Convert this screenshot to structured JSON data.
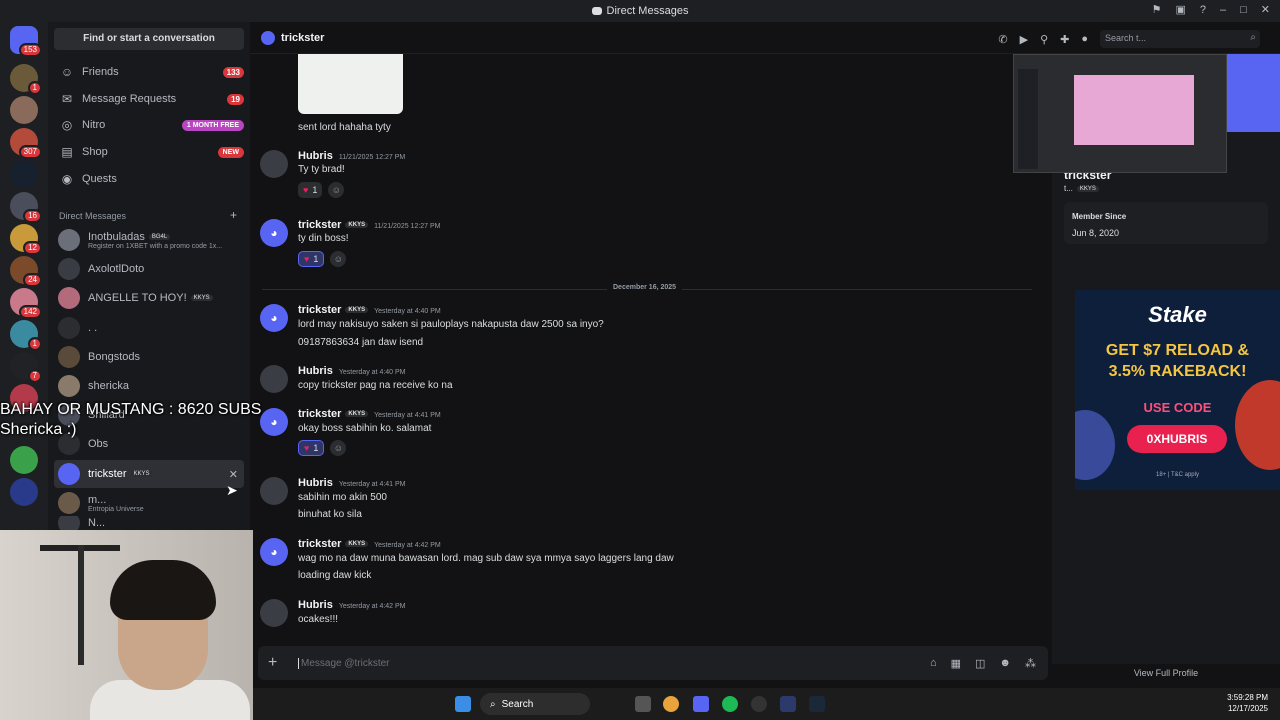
{
  "window": {
    "title": "Direct Messages"
  },
  "sidebar": {
    "find_label": "Find or start a conversation",
    "nav": [
      {
        "label": "Friends",
        "count": "133",
        "icon": "friends-icon"
      },
      {
        "label": "Message Requests",
        "count": "19",
        "icon": "mail-icon"
      },
      {
        "label": "Nitro",
        "pill": "1 MONTH FREE",
        "icon": "nitro-icon"
      },
      {
        "label": "Shop",
        "pill": "NEW",
        "icon": "shop-icon"
      },
      {
        "label": "Quests",
        "icon": "quests-icon"
      }
    ],
    "dm_header": "Direct Messages",
    "dms": [
      {
        "name": "Inotbuladas",
        "tag": "BG4L",
        "sub": "Register on 1XBET with a promo code 1x..."
      },
      {
        "name": "AxolotlDoto"
      },
      {
        "name": "ANGELLE TO HOY!",
        "tag": "KKYS"
      },
      {
        "name": ". ."
      },
      {
        "name": "Bongstods"
      },
      {
        "name": "shericka"
      },
      {
        "name": "Shillard"
      },
      {
        "name": "Obs"
      },
      {
        "name": "trickster",
        "tag": "KKYS"
      },
      {
        "name": "m...",
        "sub": "Entropia Universe"
      },
      {
        "name": "N..."
      }
    ],
    "server_badges": [
      "153",
      "1",
      "307",
      "16",
      "12",
      "24",
      "142",
      "1",
      "7"
    ]
  },
  "overlay": {
    "line1": "BAHAY OR MUSTANG : 8620 SUBS",
    "line2": "Shericka :)"
  },
  "chat": {
    "channel": "trickster",
    "search_placeholder": "Search t...",
    "date_divider": "December 16, 2025",
    "messages": [
      {
        "author": "",
        "time": "",
        "lines": [
          "sent lord hahaha tyty"
        ]
      },
      {
        "author": "Hubris",
        "time": "11/21/2025 12:27 PM",
        "lines": [
          "Ty ty brad!"
        ],
        "react": "1"
      },
      {
        "author": "trickster",
        "tag": "KKYS",
        "time": "11/21/2025 12:27 PM",
        "lines": [
          "ty din boss!"
        ],
        "react": "1"
      },
      {
        "author": "trickster",
        "tag": "KKYS",
        "time": "Yesterday at 4:40 PM",
        "lines": [
          "lord may nakisuyo saken si pauloplays nakapusta daw 2500 sa inyo?",
          "09187863634 jan daw isend"
        ]
      },
      {
        "author": "Hubris",
        "time": "Yesterday at 4:40 PM",
        "lines": [
          "copy trickster pag na receive ko na"
        ]
      },
      {
        "author": "trickster",
        "tag": "KKYS",
        "time": "Yesterday at 4:41 PM",
        "lines": [
          "okay boss sabihin ko. salamat"
        ],
        "react": "1"
      },
      {
        "author": "Hubris",
        "time": "Yesterday at 4:41 PM",
        "lines": [
          "sabihin mo akin 500",
          "binuhat ko sila"
        ]
      },
      {
        "author": "trickster",
        "tag": "KKYS",
        "time": "Yesterday at 4:42 PM",
        "lines": [
          "wag mo na daw muna bawasan lord. mag sub daw sya mmya sayo laggers lang daw",
          "loading daw kick"
        ]
      },
      {
        "author": "Hubris",
        "time": "Yesterday at 4:42 PM",
        "lines": [
          "ocakes!!!"
        ]
      }
    ],
    "composer_placeholder": "Message @trickster"
  },
  "profile": {
    "name": "trickster",
    "handle": "t...",
    "tag": "KKYS",
    "member_since_label": "Member Since",
    "member_since": "Jun 8, 2020",
    "view_full": "View Full Profile"
  },
  "ad": {
    "brand": "Stake",
    "promo_line1": "GET $7 RELOAD &",
    "promo_line2": "3.5% RAKEBACK!",
    "use_code": "USE CODE",
    "code": "0XHUBRIS",
    "tc": "18+ | T&C apply"
  },
  "taskbar": {
    "search": "Search",
    "time": "3:59:28 PM",
    "date": "12/17/2025"
  },
  "colors": {
    "accent": "#5865f2",
    "danger": "#da373c",
    "nitro": "#b845c1",
    "bg": "#121214"
  }
}
